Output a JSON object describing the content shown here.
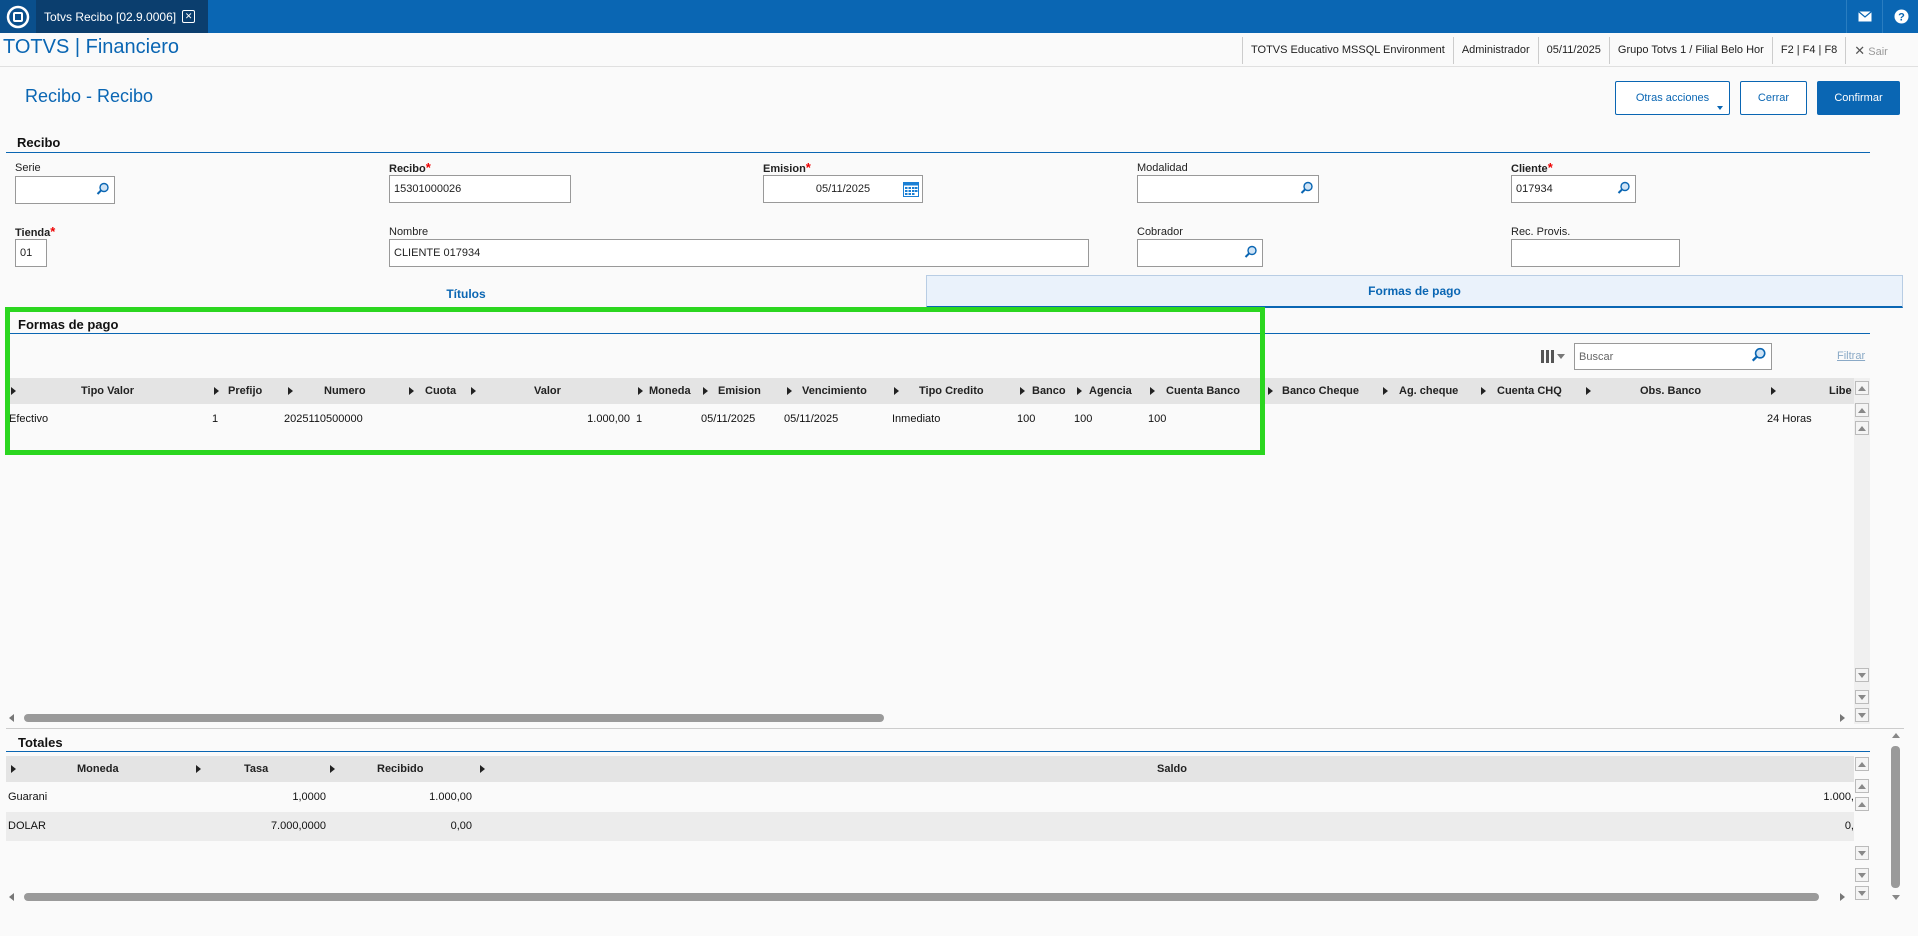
{
  "window": {
    "tab_title": "Totvs Recibo [02.9.0006]",
    "app_title": "TOTVS | Financiero"
  },
  "header_info": [
    "TOTVS Educativo MSSQL Environment",
    "Administrador",
    "05/11/2025",
    "Grupo Totvs 1 / Filial Belo Hor",
    "F2 | F4 | F8"
  ],
  "header_exit": "Sair",
  "page": {
    "title": "Recibo - Recibo",
    "buttons": {
      "otras": "Otras acciones",
      "cerrar": "Cerrar",
      "confirmar": "Confirmar"
    }
  },
  "recibo_section": {
    "title": "Recibo",
    "fields": {
      "serie": {
        "label": "Serie",
        "value": ""
      },
      "recibo": {
        "label": "Recibo",
        "value": "15301000026"
      },
      "emision": {
        "label": "Emision",
        "value": "05/11/2025"
      },
      "modalidad": {
        "label": "Modalidad",
        "value": ""
      },
      "cliente": {
        "label": "Cliente",
        "value": "017934"
      },
      "tienda": {
        "label": "Tienda",
        "value": "01"
      },
      "nombre": {
        "label": "Nombre",
        "value": "CLIENTE 017934"
      },
      "cobrador": {
        "label": "Cobrador",
        "value": ""
      },
      "rec_provis": {
        "label": "Rec. Provis.",
        "value": ""
      }
    }
  },
  "tabs": [
    "Títulos",
    "Formas de pago"
  ],
  "formas": {
    "title": "Formas de pago",
    "search_placeholder": "Buscar",
    "filter_label": "Filtrar",
    "columns": [
      "Tipo Valor",
      "Prefijo",
      "Numero",
      "Cuota",
      "Valor",
      "Moneda",
      "Emision",
      "Vencimiento",
      "Tipo Credito",
      "Banco",
      "Agencia",
      "Cuenta Banco",
      "Banco Cheque",
      "Ag. cheque",
      "Cuenta CHQ",
      "Obs. Banco",
      "Libe"
    ],
    "rows": [
      [
        "Efectivo",
        "1",
        "2025110500000",
        "",
        "1.000,00",
        "1",
        "05/11/2025",
        "05/11/2025",
        "Inmediato",
        "100",
        "100",
        "100",
        "",
        "",
        "",
        "",
        "24 Horas"
      ]
    ]
  },
  "totales": {
    "title": "Totales",
    "columns": [
      "Moneda",
      "Tasa",
      "Recibido",
      "Saldo"
    ],
    "rows": [
      [
        "Guarani",
        "1,0000",
        "1.000,00",
        "1.000,"
      ],
      [
        "DOLAR",
        "7.000,0000",
        "0,00",
        "0,"
      ]
    ]
  },
  "colors": {
    "brand": "#0a66b3",
    "highlight": "#2bd61f"
  }
}
